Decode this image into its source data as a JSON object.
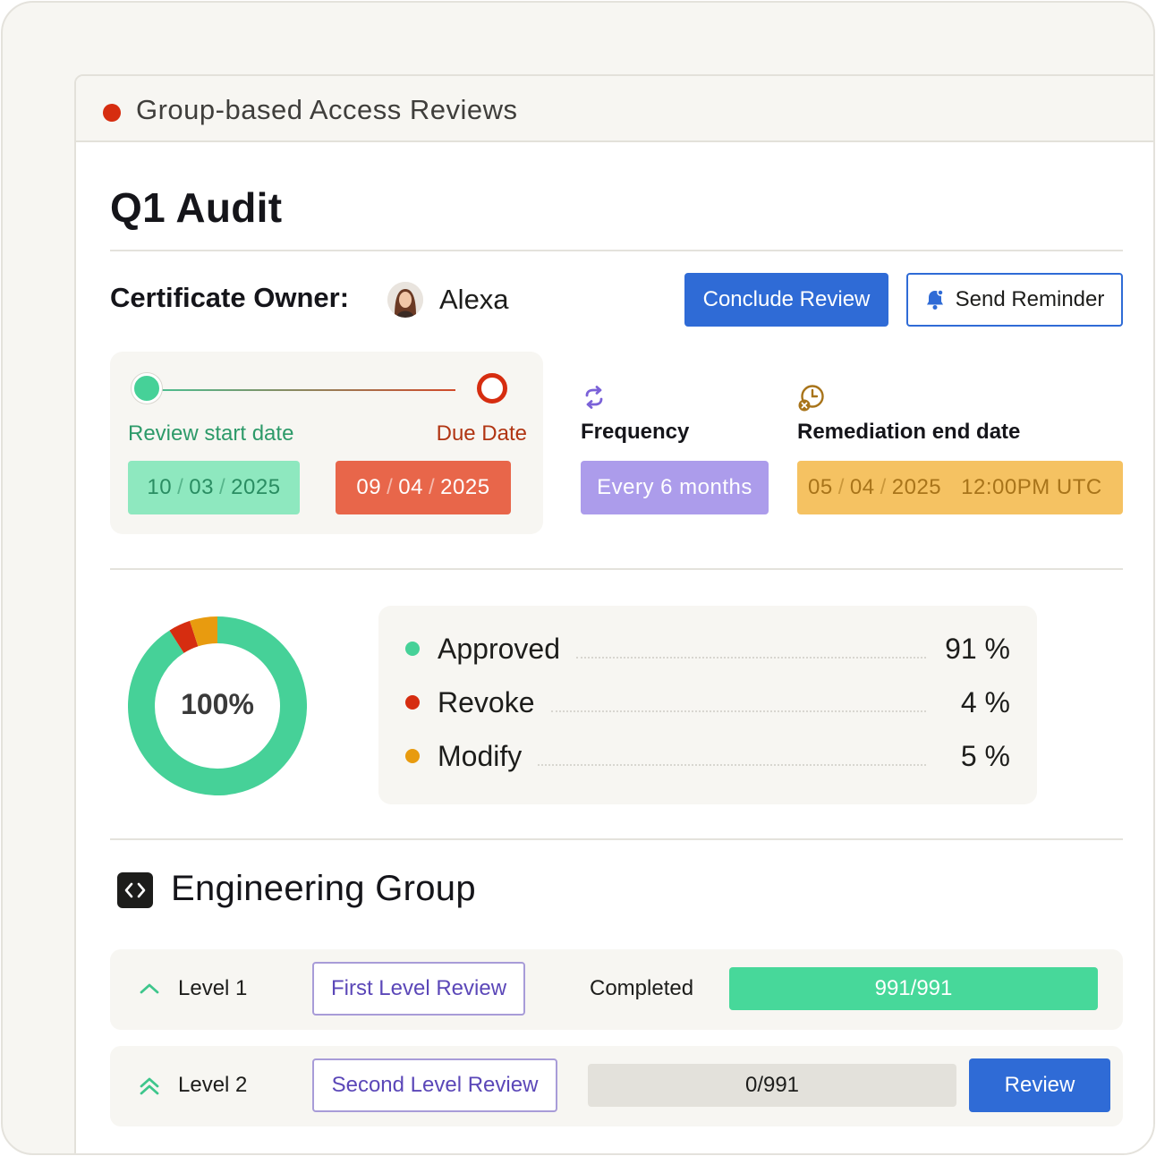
{
  "window": {
    "title": "Group-based Access Reviews",
    "status_color": "#d62d10"
  },
  "review": {
    "title": "Q1 Audit",
    "owner_label": "Certificate Owner:",
    "owner_name": "Alexa"
  },
  "actions": {
    "conclude_label": "Conclude Review",
    "reminder_label": "Send Reminder",
    "reminder_icon": "bell-icon"
  },
  "dates": {
    "start_label": "Review start date",
    "start_date": [
      "10",
      "03",
      "2025"
    ],
    "due_label": "Due Date",
    "due_date": [
      "09",
      "04",
      "2025"
    ]
  },
  "frequency": {
    "icon": "repeat-icon",
    "label": "Frequency",
    "value": "Every 6 months"
  },
  "remediation": {
    "icon": "clock-cancel-icon",
    "label": "Remediation end date",
    "date": [
      "05",
      "04",
      "2025"
    ],
    "time": "12:00PM UTC"
  },
  "summary": {
    "total_label": "100%",
    "items": [
      {
        "name": "Approved",
        "value": "91 %",
        "percent": 91,
        "color": "#46d198"
      },
      {
        "name": "Revoke",
        "value": "4 %",
        "percent": 4,
        "color": "#d62d10"
      },
      {
        "name": "Modify",
        "value": "5 %",
        "percent": 5,
        "color": "#e89b0f"
      }
    ]
  },
  "group": {
    "icon": "code-icon",
    "name": "Engineering Group",
    "levels": [
      {
        "icon": "chevron-up-icon",
        "name": "Level 1",
        "button": "First Level Review",
        "status": "Completed",
        "progress": "991/991",
        "done": 991,
        "total": 991
      },
      {
        "icon": "double-chevron-up-icon",
        "name": "Level 2",
        "button": "Second Level Review",
        "progress": "0/991",
        "done": 0,
        "total": 991,
        "action": "Review"
      }
    ]
  }
}
